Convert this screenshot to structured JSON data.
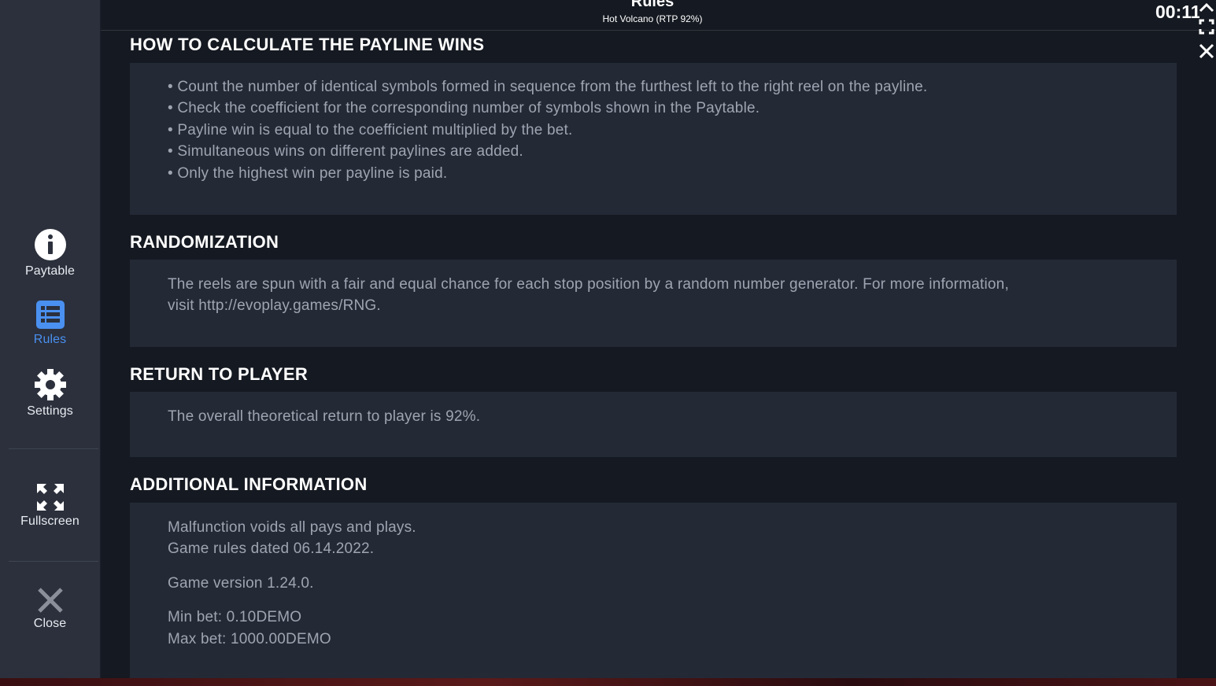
{
  "header": {
    "title": "Rules",
    "subtitle": "Hot Volcano (RTP 92%)",
    "clock": "00:11"
  },
  "sidebar": {
    "items": [
      {
        "label": "Paytable",
        "icon": "info-icon"
      },
      {
        "label": "Rules",
        "icon": "list-icon",
        "active": true
      },
      {
        "label": "Settings",
        "icon": "gear-icon"
      },
      {
        "label": "Fullscreen",
        "icon": "fullscreen-icon"
      },
      {
        "label": "Close",
        "icon": "close-icon"
      }
    ]
  },
  "sections": {
    "payline": {
      "title": "HOW TO CALCULATE THE PAYLINE WINS",
      "lines": [
        "• Count the number of identical symbols formed in sequence from the furthest left to the right reel on the payline.",
        "• Check the coefficient for the corresponding number of symbols shown in the Paytable.",
        "• Payline win is equal to the coefficient multiplied by the bet.",
        "• Simultaneous wins on different paylines are added.",
        "• Only the highest win per payline is paid."
      ]
    },
    "randomization": {
      "title": "RANDOMIZATION",
      "lines": [
        "The reels are spun with a fair and equal chance for each stop position by a random number generator. For more information,",
        "visit http://evoplay.games/RNG."
      ]
    },
    "rtp": {
      "title": "RETURN TO PLAYER",
      "lines": [
        "The overall theoretical return to player is 92%."
      ]
    },
    "additional": {
      "title": "ADDITIONAL INFORMATION",
      "lines": [
        "Malfunction voids all pays and plays.",
        "Game rules dated 06.14.2022.",
        "Game version 1.24.0.",
        "Min bet: 0.10DEMO",
        "Max bet: 1000.00DEMO"
      ]
    }
  },
  "colors": {
    "accent": "#4a90f0",
    "sidebar_bg": "#2b303c",
    "panel_bg": "#242936",
    "main_bg": "#151921",
    "body_text": "#9ea5b1"
  }
}
